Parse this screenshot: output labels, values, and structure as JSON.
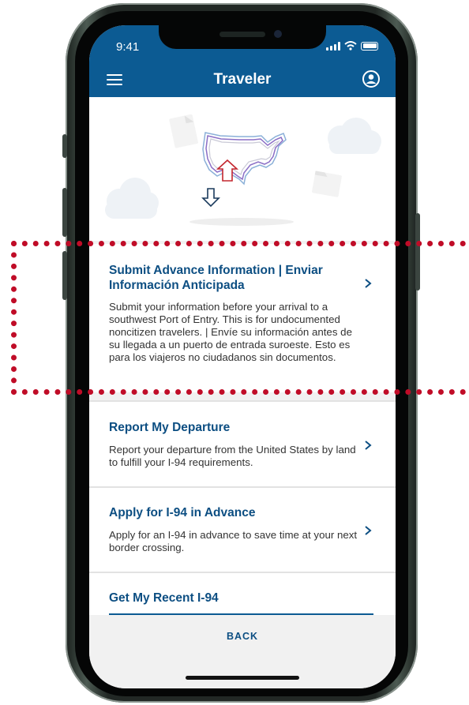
{
  "status_bar": {
    "time": "9:41"
  },
  "header": {
    "title": "Traveler"
  },
  "cards": [
    {
      "title": "Submit Advance Information | Enviar Información Anticipada",
      "description": "Submit your information before your arrival to a southwest Port of Entry. This is for undocumented noncitizen travelers. | Envíe su información antes de su llegada a un puerto de entrada suroeste. Esto es para los viajeros no ciudadanos sin documentos."
    },
    {
      "title": "Report My Departure",
      "description": "Report your departure from the United States by land to fulfill your I-94 requirements."
    },
    {
      "title": "Apply for I-94 in Advance",
      "description": "Apply for an I-94 in advance to save time at your next border crossing."
    },
    {
      "title": "Get My Recent I-94",
      "description": ""
    }
  ],
  "footer": {
    "back_label": "BACK"
  },
  "colors": {
    "brand_blue": "#0c5b93",
    "title_blue": "#0c4e82",
    "highlight_red": "#c00c27"
  },
  "icons": [
    "menu-icon",
    "profile-icon",
    "chevron-right-icon",
    "us-map-illustration",
    "signal-icon",
    "wifi-icon",
    "battery-icon"
  ]
}
